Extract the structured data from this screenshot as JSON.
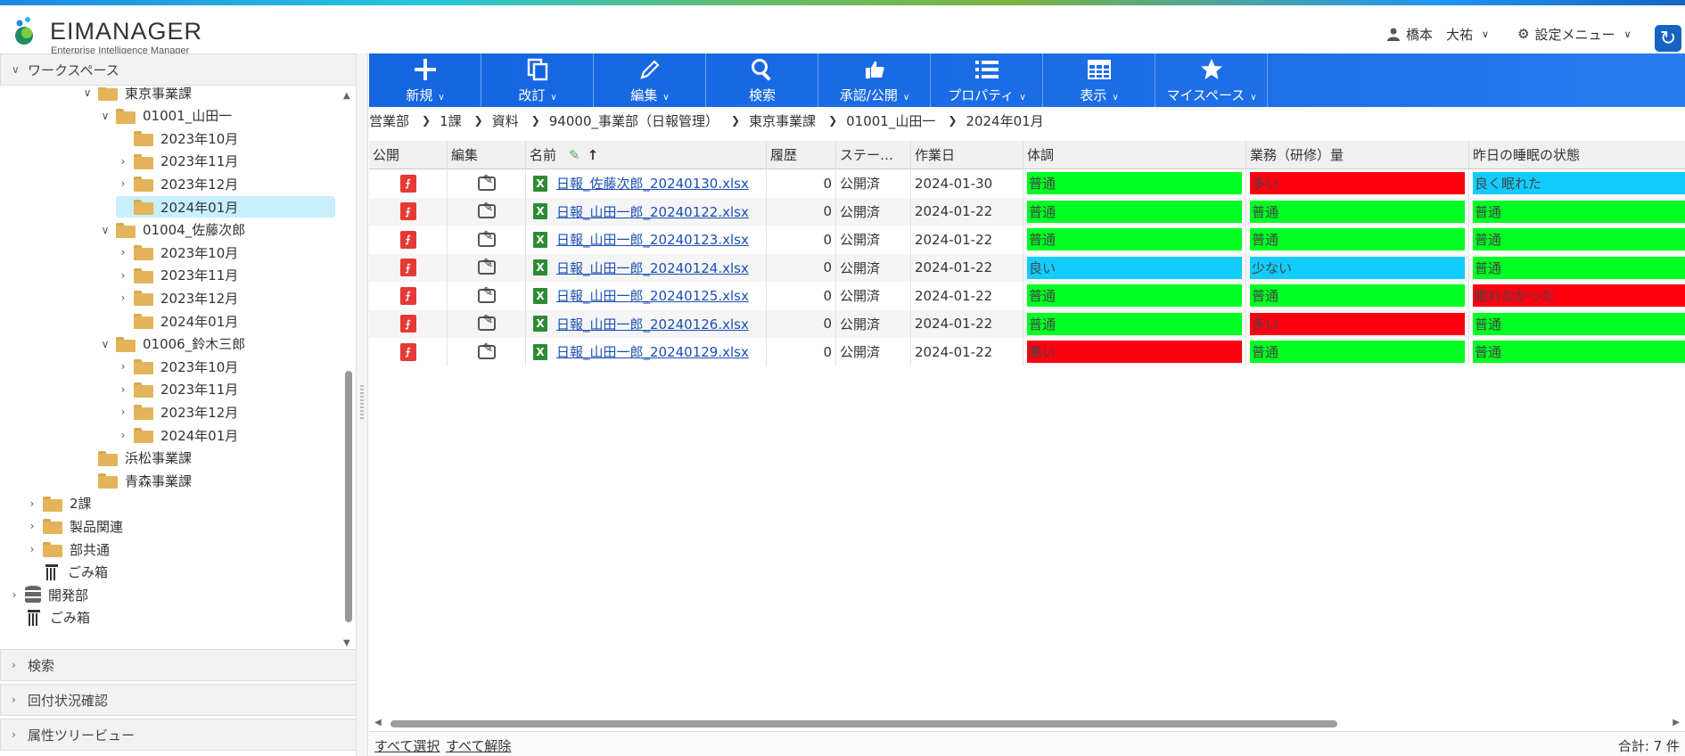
{
  "header": {
    "logo_name": "EIMANAGER",
    "logo_sub": "Enterprise Intelligence Manager",
    "user_name": "橋本　大祐",
    "settings_label": "設定メニュー"
  },
  "sidebar": {
    "workspace_label": "ワークスペース",
    "tree": [
      {
        "label": "東京事業課",
        "level": 1,
        "toggle": "v",
        "type": "folder"
      },
      {
        "label": "01001_山田一",
        "level": 2,
        "toggle": "v",
        "type": "folder"
      },
      {
        "label": "2023年10月",
        "level": 3,
        "toggle": "",
        "type": "folder"
      },
      {
        "label": "2023年11月",
        "level": 3,
        "toggle": ">",
        "type": "folder"
      },
      {
        "label": "2023年12月",
        "level": 3,
        "toggle": ">",
        "type": "folder"
      },
      {
        "label": "2024年01月",
        "level": 3,
        "toggle": "",
        "type": "folder",
        "selected": true
      },
      {
        "label": "01004_佐藤次郎",
        "level": 2,
        "toggle": "v",
        "type": "folder"
      },
      {
        "label": "2023年10月",
        "level": 3,
        "toggle": ">",
        "type": "folder"
      },
      {
        "label": "2023年11月",
        "level": 3,
        "toggle": ">",
        "type": "folder"
      },
      {
        "label": "2023年12月",
        "level": 3,
        "toggle": ">",
        "type": "folder"
      },
      {
        "label": "2024年01月",
        "level": 3,
        "toggle": "",
        "type": "folder"
      },
      {
        "label": "01006_鈴木三郎",
        "level": 2,
        "toggle": "v",
        "type": "folder"
      },
      {
        "label": "2023年10月",
        "level": 3,
        "toggle": ">",
        "type": "folder"
      },
      {
        "label": "2023年11月",
        "level": 3,
        "toggle": ">",
        "type": "folder"
      },
      {
        "label": "2023年12月",
        "level": 3,
        "toggle": ">",
        "type": "folder"
      },
      {
        "label": "2024年01月",
        "level": 3,
        "toggle": ">",
        "type": "folder"
      },
      {
        "label": "浜松事業課",
        "level": 1,
        "toggle": "",
        "type": "folder"
      },
      {
        "label": "青森事業課",
        "level": 1,
        "toggle": "",
        "type": "folder"
      },
      {
        "label": "2課",
        "level": 0,
        "toggle": ">",
        "type": "folder"
      },
      {
        "label": "製品関連",
        "level": 0,
        "toggle": ">",
        "type": "folder"
      },
      {
        "label": "部共通",
        "level": 0,
        "toggle": ">",
        "type": "folder"
      },
      {
        "label": "ごみ箱",
        "level": 0,
        "toggle": "",
        "type": "trash"
      },
      {
        "label": "開発部",
        "level": -1,
        "toggle": ">",
        "type": "db"
      },
      {
        "label": "ごみ箱",
        "level": -1,
        "toggle": "",
        "type": "trash"
      }
    ],
    "panels": [
      "検索",
      "回付状況確認",
      "属性ツリービュー"
    ]
  },
  "toolbar": {
    "buttons": [
      {
        "label": "新規",
        "icon": "plus-icon",
        "caret": true
      },
      {
        "label": "改訂",
        "icon": "copy-icon",
        "caret": true
      },
      {
        "label": "編集",
        "icon": "pencil-icon",
        "caret": true
      },
      {
        "label": "検索",
        "icon": "search-icon",
        "caret": false
      },
      {
        "label": "承認/公開",
        "icon": "thumbs-up-icon",
        "caret": true
      },
      {
        "label": "プロパティ",
        "icon": "list-icon",
        "caret": true
      },
      {
        "label": "表示",
        "icon": "table-icon",
        "caret": true
      },
      {
        "label": "マイスペース",
        "icon": "star-icon",
        "caret": true
      }
    ]
  },
  "breadcrumb": [
    "営業部",
    "1課",
    "資料",
    "94000_事業部（日報管理）",
    "東京事業課",
    "01001_山田一",
    "2024年01月"
  ],
  "grid": {
    "headers": [
      "公開",
      "編集",
      "名前",
      "履歴",
      "ステー…",
      "作業日",
      "体調",
      "業務（研修）量",
      "昨日の睡眠の状態"
    ],
    "rows": [
      {
        "name": "日報_佐藤次郎_20240130.xlsx",
        "history": "0",
        "status": "公開済",
        "date": "2024-01-30",
        "cond": "普通",
        "work": "多い",
        "sleep": "良く眠れた"
      },
      {
        "name": "日報_山田一郎_20240122.xlsx",
        "history": "0",
        "status": "公開済",
        "date": "2024-01-22",
        "cond": "普通",
        "work": "普通",
        "sleep": "普通"
      },
      {
        "name": "日報_山田一郎_20240123.xlsx",
        "history": "0",
        "status": "公開済",
        "date": "2024-01-22",
        "cond": "普通",
        "work": "普通",
        "sleep": "普通"
      },
      {
        "name": "日報_山田一郎_20240124.xlsx",
        "history": "0",
        "status": "公開済",
        "date": "2024-01-22",
        "cond": "良い",
        "work": "少ない",
        "sleep": "普通"
      },
      {
        "name": "日報_山田一郎_20240125.xlsx",
        "history": "0",
        "status": "公開済",
        "date": "2024-01-22",
        "cond": "普通",
        "work": "普通",
        "sleep": "眠れなかった"
      },
      {
        "name": "日報_山田一郎_20240126.xlsx",
        "history": "0",
        "status": "公開済",
        "date": "2024-01-22",
        "cond": "普通",
        "work": "多い",
        "sleep": "普通"
      },
      {
        "name": "日報_山田一郎_20240129.xlsx",
        "history": "0",
        "status": "公開済",
        "date": "2024-01-22",
        "cond": "悪い",
        "work": "普通",
        "sleep": "普通"
      }
    ],
    "status_colors": {
      "普通": "#00ff22",
      "良い": "#11ccff",
      "多い": "#ff0011",
      "少ない": "#11ccff",
      "良く眠れた": "#11ccff",
      "眠れなかった": "#ff0011",
      "悪い": "#ff0011"
    }
  },
  "footer": {
    "select_all": "すべて選択",
    "clear_all": "すべて解除",
    "total": "合計: 7 件"
  }
}
